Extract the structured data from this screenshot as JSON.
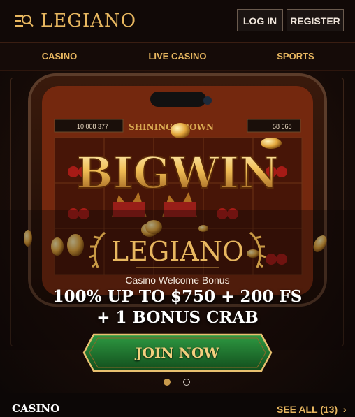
{
  "header": {
    "logo": "LEGIANO",
    "login_label": "LOG IN",
    "register_label": "REGISTER",
    "menu_icon": "menu-search-icon"
  },
  "nav": {
    "items": [
      {
        "label": "CASINO"
      },
      {
        "label": "LIVE CASINO"
      },
      {
        "label": "SPORTS"
      }
    ]
  },
  "banner": {
    "big_win": "BIGWIN",
    "game_title": "SHINING CROWN",
    "balance_left": "10 008 377",
    "balance_right": "58 668",
    "logo": "LEGIANO",
    "subtitle": "Casino Welcome Bonus",
    "offer_line_1": "100% UP TO $750 + 200 FS",
    "offer_line_2": "+ 1 BONUS CRAB",
    "cta_label": "JOIN NOW",
    "slides": 2,
    "active_slide": 1
  },
  "section": {
    "title": "CASINO",
    "see_all_label": "SEE ALL (13)"
  },
  "colors": {
    "gold": "#e8b760",
    "background": "#0c0706",
    "cta_green": "#1f6b2e"
  }
}
